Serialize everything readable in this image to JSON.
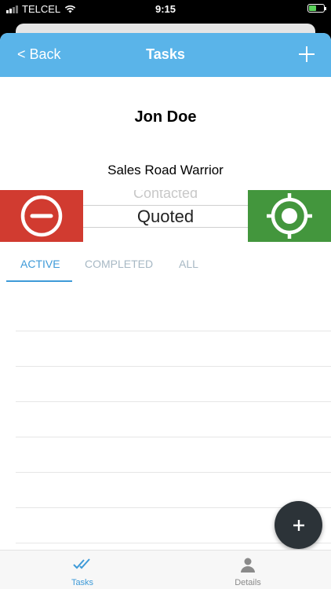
{
  "status_bar": {
    "carrier": "TELCEL",
    "time": "9:15"
  },
  "nav": {
    "back_label": "< Back",
    "title": "Tasks"
  },
  "contact": {
    "name": "Jon Doe",
    "role": "Sales Road Warrior"
  },
  "stage_picker": {
    "previous": "Contacted",
    "selected": "Quoted"
  },
  "tabs": [
    {
      "label": "ACTIVE"
    },
    {
      "label": "COMPLETED"
    },
    {
      "label": "ALL"
    }
  ],
  "tabbar": [
    {
      "label": "Tasks",
      "icon": "double-check-icon"
    },
    {
      "label": "Details",
      "icon": "person-icon"
    }
  ],
  "colors": {
    "nav": "#5ab4e9",
    "remove": "#d13b30",
    "locate": "#43963d",
    "accent": "#3e9ad8",
    "fab": "#2c3338"
  }
}
